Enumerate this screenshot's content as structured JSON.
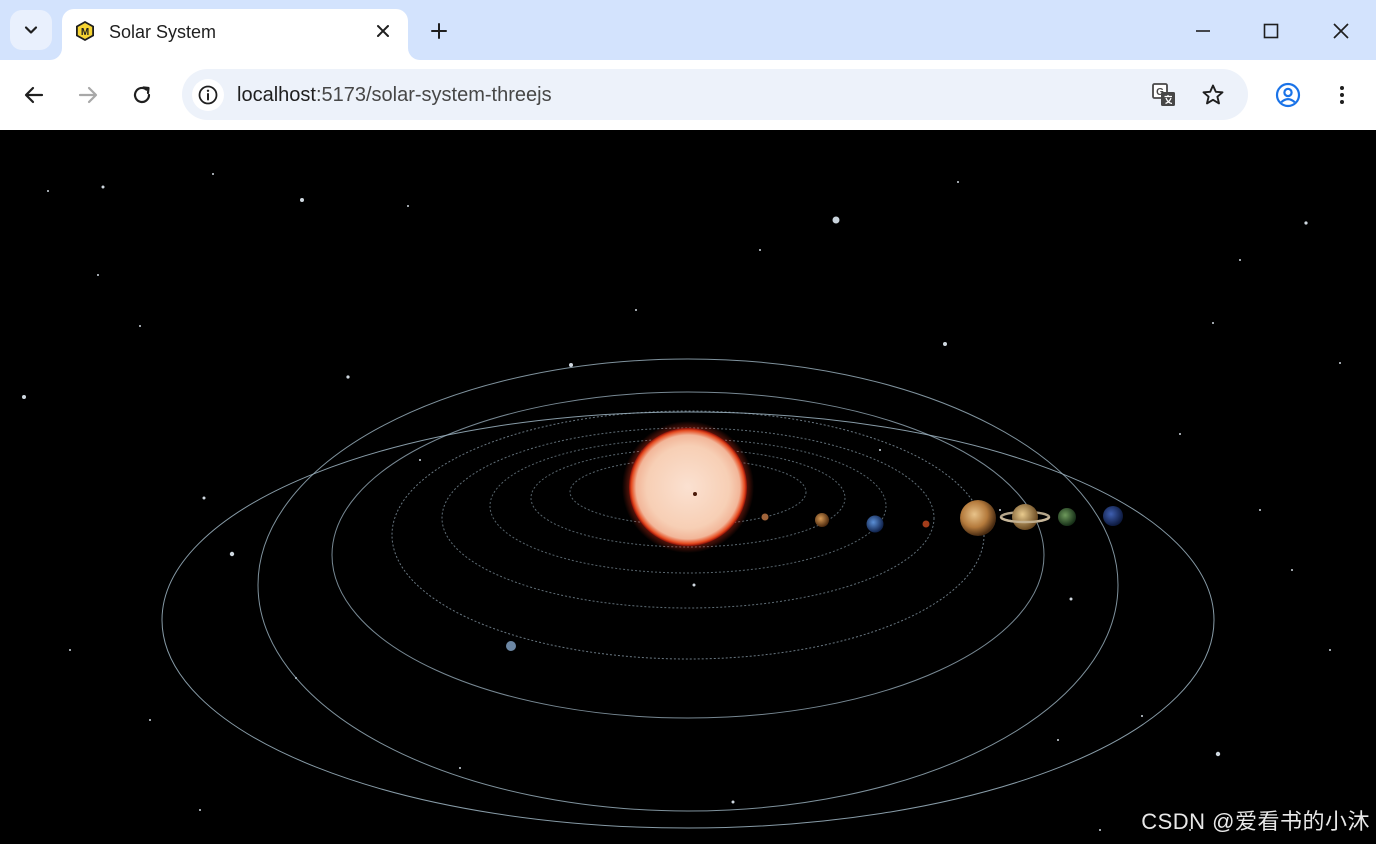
{
  "browser": {
    "tab": {
      "title": "Solar System",
      "favicon_letter": "M",
      "favicon_color": "#f6d433"
    },
    "address_bar": {
      "url_host": "localhost",
      "url_path": ":5173/solar-system-threejs"
    },
    "icons": {
      "tab_search": "chevron-down-icon",
      "close_tab": "close-icon",
      "new_tab": "plus-icon",
      "back": "arrow-left-icon",
      "forward": "arrow-right-icon",
      "reload": "reload-icon",
      "site_info": "info-icon",
      "translate": "translate-icon",
      "bookmark": "star-icon",
      "profile": "profile-icon",
      "menu": "kebab-menu-icon",
      "minimize": "minimize-icon",
      "maximize": "maximize-icon",
      "close_window": "close-icon"
    },
    "colors": {
      "tabstrip": "#d3e3fd",
      "omnibox": "#edf2fa",
      "profile_accent": "#1a73e8"
    }
  },
  "scene": {
    "sun_color": "#f7cfb5",
    "sun_glow": "#d0251a",
    "orbit_color": "#9fb6c4",
    "background": "#000000",
    "bodies": [
      "mercury",
      "venus",
      "earth",
      "mars",
      "jupiter",
      "saturn",
      "uranus",
      "neptune"
    ]
  },
  "watermark": {
    "text": "CSDN @爱看书的小沐"
  }
}
